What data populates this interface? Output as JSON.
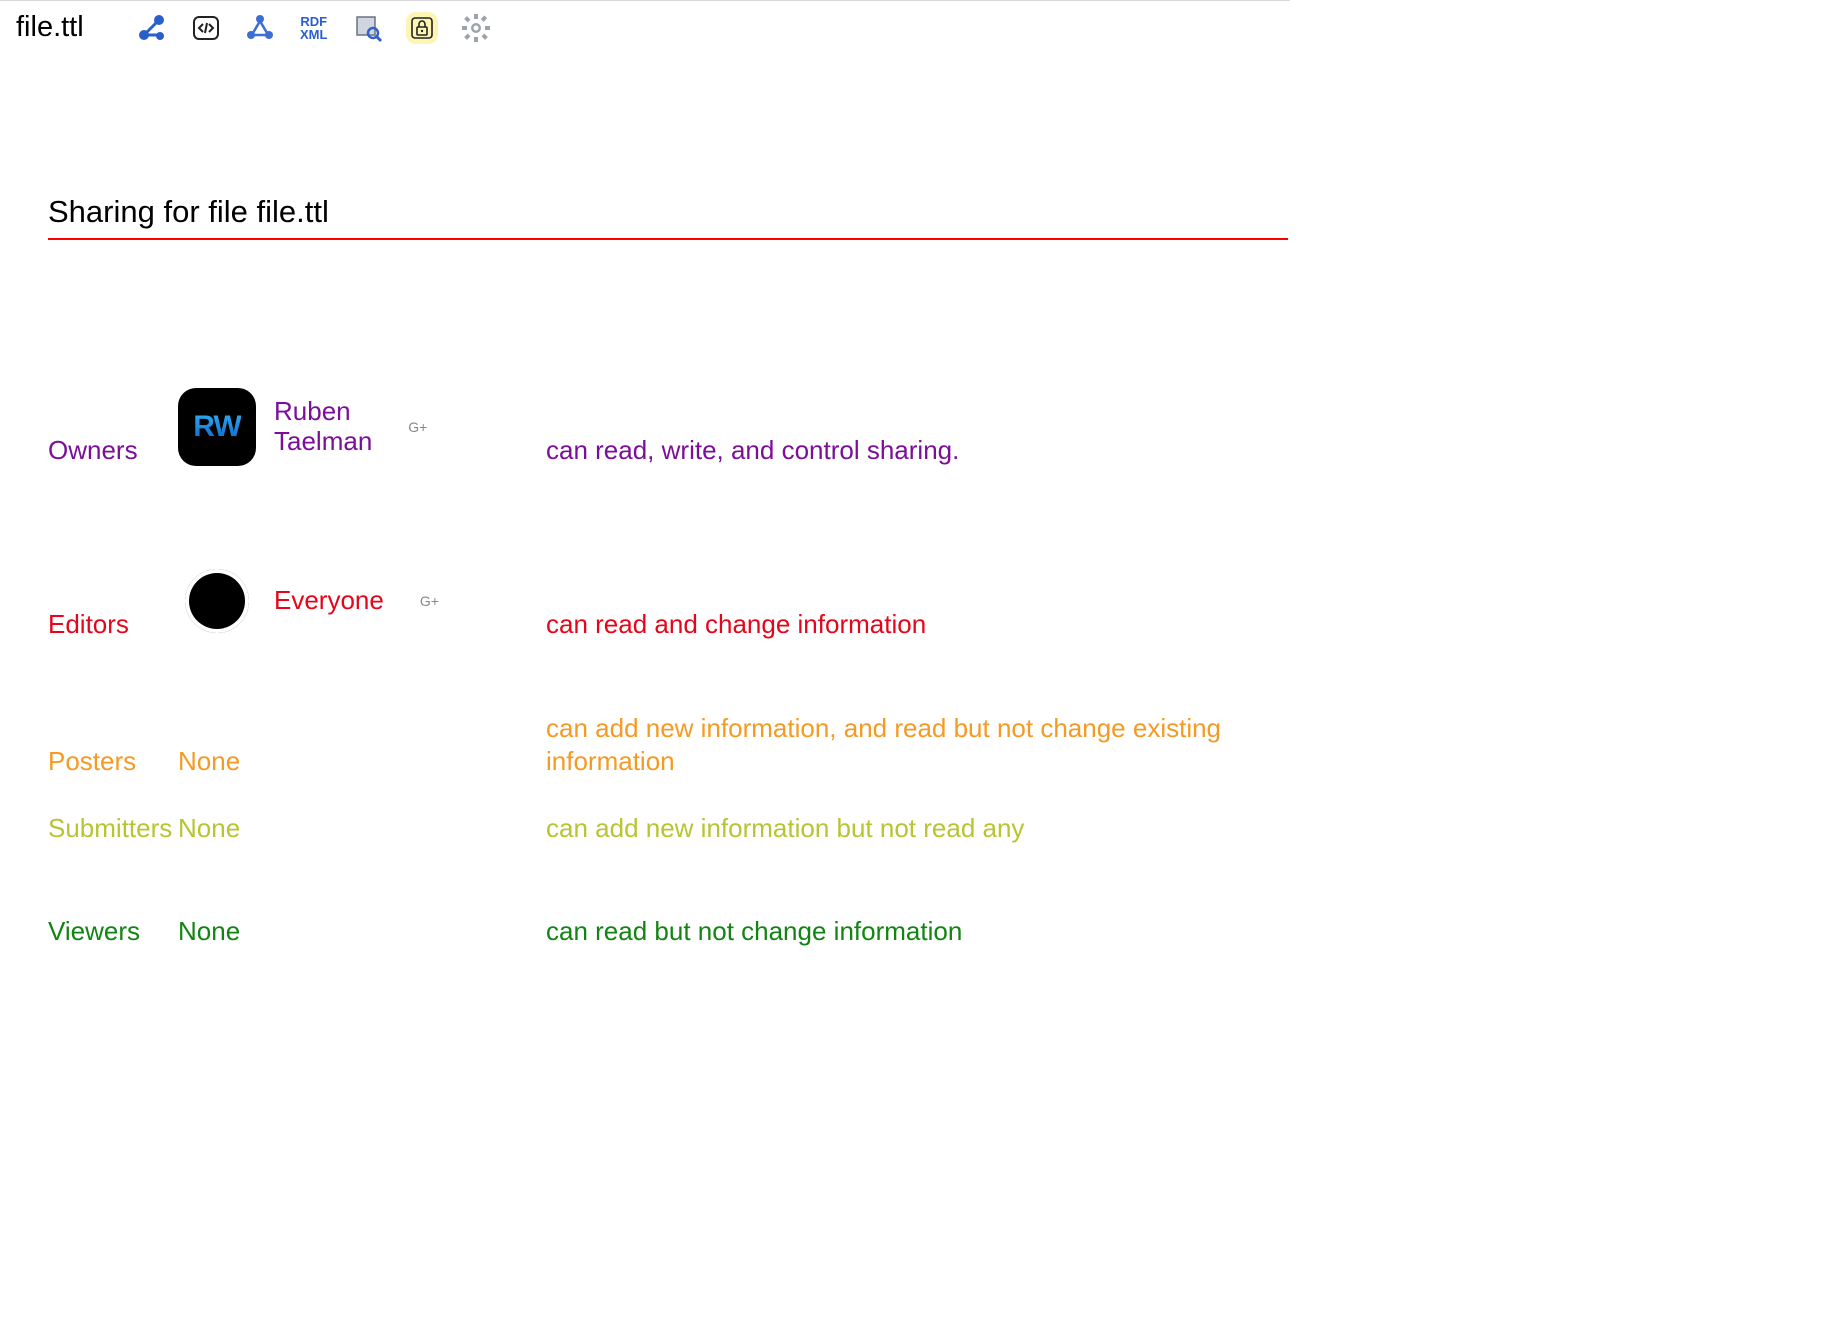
{
  "header": {
    "filename": "file.ttl"
  },
  "heading": "Sharing for file file.ttl",
  "rows": {
    "owners": {
      "role_label": "Owners",
      "who_label": "Ruben\nTaelman",
      "desc": "can read, write, and control sharing.",
      "add_glyph": "G+"
    },
    "editors": {
      "role_label": "Editors",
      "who_label": "Everyone",
      "desc": "can read and change information",
      "add_glyph": "G+"
    },
    "posters": {
      "role_label": "Posters",
      "who_label": "None",
      "desc": "can add new information, and read but not change existing information"
    },
    "submitters": {
      "role_label": "Submitters",
      "who_label": "None",
      "desc": "can add new information but not read any"
    },
    "viewers": {
      "role_label": "Viewers",
      "who_label": "None",
      "desc": "can read but not change information"
    }
  },
  "avatars": {
    "rw_glyph": "RW"
  }
}
